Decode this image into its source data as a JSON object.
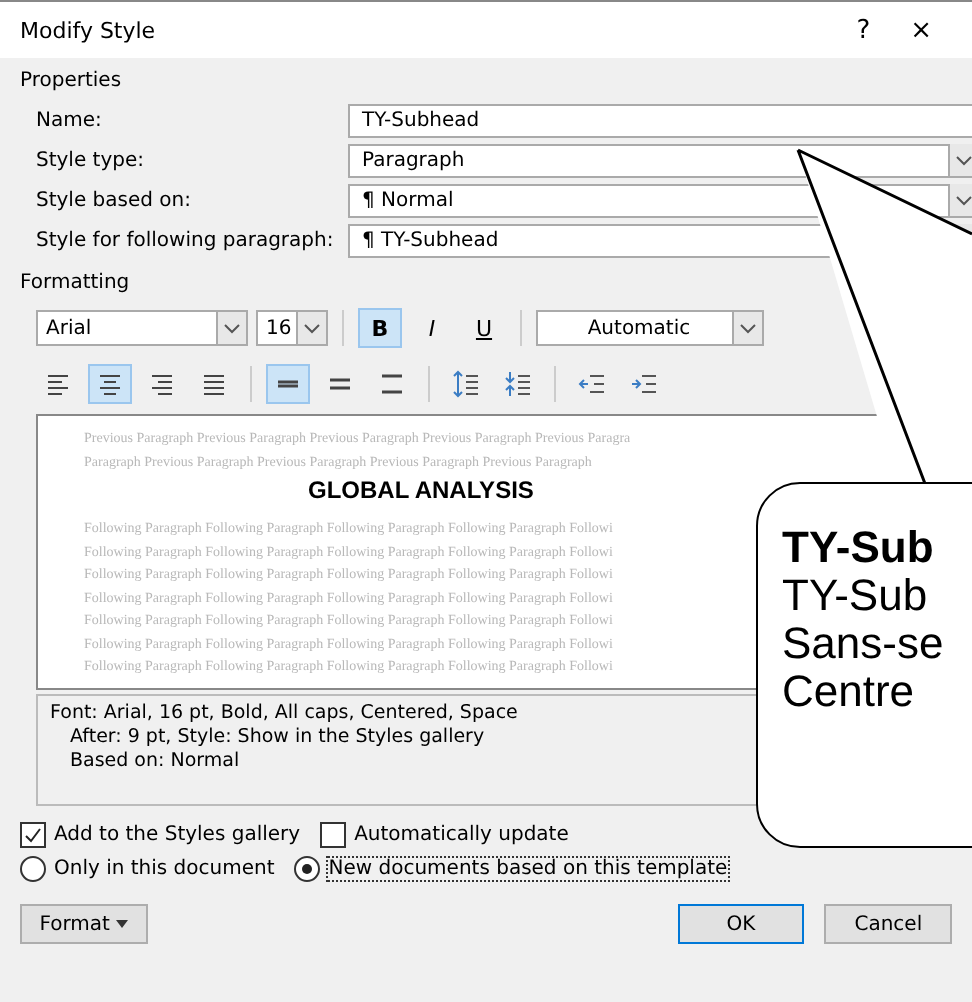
{
  "window": {
    "title": "Modify Style",
    "help": "?",
    "close": "×"
  },
  "properties": {
    "heading": "Properties",
    "fields": [
      {
        "label": "Name:",
        "kind": "text",
        "value": "TY-Subhead"
      },
      {
        "label": "Style type:",
        "kind": "dropdown",
        "value": "Paragraph"
      },
      {
        "label": "Style based on:",
        "kind": "dropdown",
        "value": "¶ Normal"
      },
      {
        "label": "Style for following paragraph:",
        "kind": "dropdown",
        "value": "¶ TY-Subhead"
      }
    ]
  },
  "formatting": {
    "heading": "Formatting",
    "font": "Arial",
    "size": "16",
    "style_buttons": [
      {
        "label": "B",
        "kind": "bold",
        "selected": true
      },
      {
        "label": "I",
        "kind": "italic",
        "selected": false
      },
      {
        "label": "U",
        "kind": "underline",
        "selected": false
      }
    ],
    "color_label": "Automatic",
    "align_buttons": [
      {
        "kind": "left",
        "selected": false
      },
      {
        "kind": "center",
        "selected": true
      },
      {
        "kind": "right",
        "selected": false
      },
      {
        "kind": "justify",
        "selected": false
      }
    ],
    "spacing_buttons": [
      {
        "kind": "single",
        "selected": true
      },
      {
        "kind": "onehalf",
        "selected": false
      },
      {
        "kind": "double",
        "selected": false
      }
    ],
    "preview": {
      "previous": [
        "Previous Paragraph Previous Paragraph Previous Paragraph Previous Paragraph Previous Paragra",
        "Paragraph Previous Paragraph Previous Paragraph Previous Paragraph Previous Paragraph"
      ],
      "sample": "GLOBAL ANALYSIS",
      "following": [
        "Following Paragraph Following Paragraph Following Paragraph Following Paragraph Followi",
        "Following Paragraph Following Paragraph Following Paragraph Following Paragraph Followi",
        "Following Paragraph Following Paragraph Following Paragraph Following Paragraph Followi",
        "Following Paragraph Following Paragraph Following Paragraph Following Paragraph Followi",
        "Following Paragraph Following Paragraph Following Paragraph Following Paragraph Followi",
        "Following Paragraph Following Paragraph Following Paragraph Following Paragraph Followi",
        "Following Paragraph Following Paragraph Following Paragraph Following Paragraph Followi"
      ]
    },
    "description": [
      "Font: Arial, 16 pt, Bold, All caps, Centered, Space",
      "After:  9 pt, Style: Show in the Styles gallery",
      "Based on: Normal"
    ]
  },
  "options": {
    "checkboxes": [
      {
        "label": "Add to the Styles gallery",
        "checked": true
      },
      {
        "label": "Automatically update",
        "checked": false
      }
    ],
    "radios": [
      {
        "label": "Only in this document",
        "selected": false
      },
      {
        "label": "New documents based on this template",
        "selected": true
      }
    ]
  },
  "buttons": {
    "format": "Format",
    "ok": "OK",
    "cancel": "Cancel"
  },
  "callout": {
    "title": "TY-Sub",
    "lines": [
      "TY-Sub",
      "Sans-se",
      "Centre"
    ]
  }
}
